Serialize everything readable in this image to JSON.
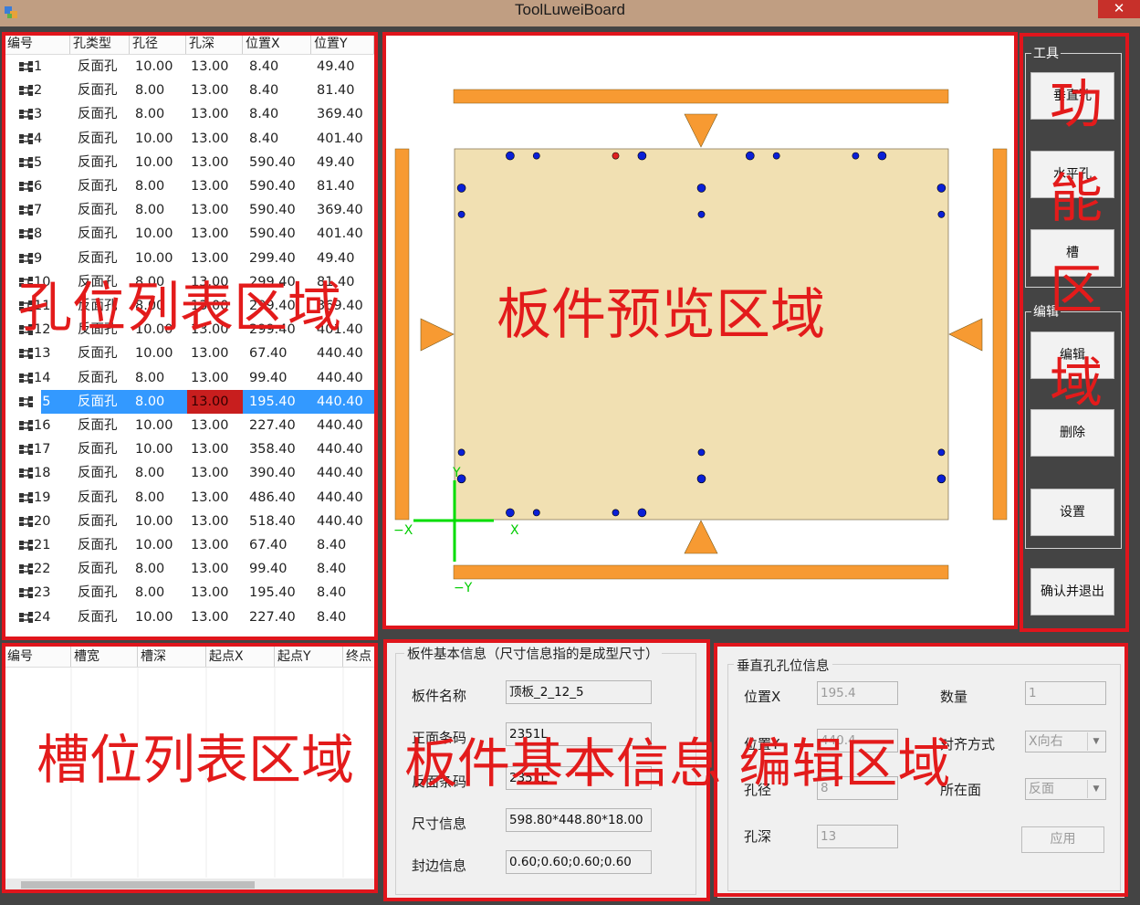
{
  "window": {
    "title": "ToolLuweiBoard",
    "close_glyph": "✕"
  },
  "hole_table": {
    "headers": [
      "编号",
      "孔类型",
      "孔径",
      "孔深",
      "位置X",
      "位置Y"
    ],
    "rows": [
      [
        "1",
        "反面孔",
        "10.00",
        "13.00",
        "8.40",
        "49.40"
      ],
      [
        "2",
        "反面孔",
        "8.00",
        "13.00",
        "8.40",
        "81.40"
      ],
      [
        "3",
        "反面孔",
        "8.00",
        "13.00",
        "8.40",
        "369.40"
      ],
      [
        "4",
        "反面孔",
        "10.00",
        "13.00",
        "8.40",
        "401.40"
      ],
      [
        "5",
        "反面孔",
        "10.00",
        "13.00",
        "590.40",
        "49.40"
      ],
      [
        "6",
        "反面孔",
        "8.00",
        "13.00",
        "590.40",
        "81.40"
      ],
      [
        "7",
        "反面孔",
        "8.00",
        "13.00",
        "590.40",
        "369.40"
      ],
      [
        "8",
        "反面孔",
        "10.00",
        "13.00",
        "590.40",
        "401.40"
      ],
      [
        "9",
        "反面孔",
        "10.00",
        "13.00",
        "299.40",
        "49.40"
      ],
      [
        "10",
        "反面孔",
        "8.00",
        "13.00",
        "299.40",
        "81.40"
      ],
      [
        "11",
        "反面孔",
        "8.00",
        "13.00",
        "299.40",
        "369.40"
      ],
      [
        "12",
        "反面孔",
        "10.00",
        "13.00",
        "299.40",
        "401.40"
      ],
      [
        "13",
        "反面孔",
        "10.00",
        "13.00",
        "67.40",
        "440.40"
      ],
      [
        "14",
        "反面孔",
        "8.00",
        "13.00",
        "99.40",
        "440.40"
      ],
      [
        "15",
        "反面孔",
        "8.00",
        "13.00",
        "195.40",
        "440.40"
      ],
      [
        "16",
        "反面孔",
        "10.00",
        "13.00",
        "227.40",
        "440.40"
      ],
      [
        "17",
        "反面孔",
        "10.00",
        "13.00",
        "358.40",
        "440.40"
      ],
      [
        "18",
        "反面孔",
        "8.00",
        "13.00",
        "390.40",
        "440.40"
      ],
      [
        "19",
        "反面孔",
        "8.00",
        "13.00",
        "486.40",
        "440.40"
      ],
      [
        "20",
        "反面孔",
        "10.00",
        "13.00",
        "518.40",
        "440.40"
      ],
      [
        "21",
        "反面孔",
        "10.00",
        "13.00",
        "67.40",
        "8.40"
      ],
      [
        "22",
        "反面孔",
        "8.00",
        "13.00",
        "99.40",
        "8.40"
      ],
      [
        "23",
        "反面孔",
        "8.00",
        "13.00",
        "195.40",
        "8.40"
      ],
      [
        "24",
        "反面孔",
        "10.00",
        "13.00",
        "227.40",
        "8.40"
      ]
    ],
    "selected_row": 15
  },
  "slot_table": {
    "headers": [
      "编号",
      "槽宽",
      "槽深",
      "起点X",
      "起点Y",
      "终点"
    ]
  },
  "preview": {
    "axis_labels": {
      "x_pos": "X",
      "x_neg": "−X",
      "y_pos": "Y",
      "y_neg": "−Y"
    }
  },
  "tools": {
    "group_tools": "工具",
    "vertical_hole": "垂直孔",
    "horizontal_hole": "水平孔",
    "slot": "槽",
    "group_edit": "编辑",
    "edit": "编辑",
    "delete": "删除",
    "settings": "设置",
    "confirm_exit": "确认并退出"
  },
  "board_info": {
    "legend": "板件基本信息（尺寸信息指的是成型尺寸）",
    "name_label": "板件名称",
    "name_value": "顶板_2_12_5",
    "front_barcode_label": "正面条码",
    "front_barcode_value": "2351L",
    "back_barcode_label": "反面条码",
    "back_barcode_value": "2351L",
    "size_label": "尺寸信息",
    "size_value": "598.80*448.80*18.00",
    "edge_label": "封边信息",
    "edge_value": "0.60;0.60;0.60;0.60"
  },
  "vhole_info": {
    "legend": "垂直孔孔位信息",
    "pos_x_label": "位置X",
    "pos_x_value": "195.4",
    "pos_y_label": "位置Y",
    "pos_y_value": "440.4",
    "diameter_label": "孔径",
    "diameter_value": "8",
    "depth_label": "孔深",
    "depth_value": "13",
    "count_label": "数量",
    "count_value": "1",
    "align_label": "对齐方式",
    "align_value": "X向右",
    "face_label": "所在面",
    "face_value": "反面",
    "apply_label": "应用"
  },
  "annotations": {
    "hole_list": "孔位列表区域",
    "preview": "板件预览区域",
    "slot_list": "槽位列表区域",
    "info_edit": "板件基本信息  编辑区域",
    "func_1": "功",
    "func_2": "能",
    "func_3": "区",
    "func_4": "域"
  },
  "colors": {
    "red": "#e0151c",
    "board": "#f1e0b2",
    "orange": "#f79a32",
    "hole_blue": "#0a1fd6",
    "hole_red": "#e02020",
    "selection": "#3399ff",
    "highlight_cell": "#c81e1e"
  }
}
